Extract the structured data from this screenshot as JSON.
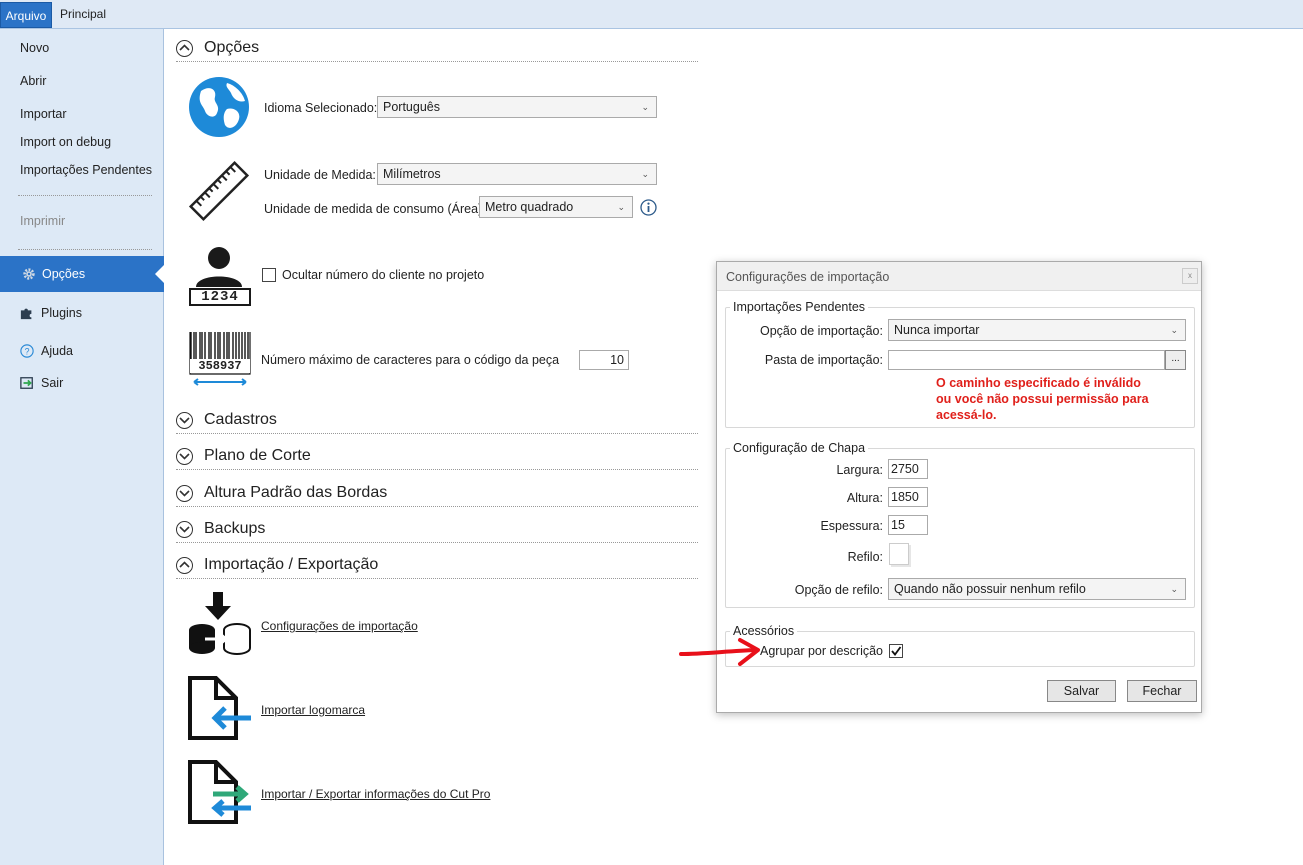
{
  "ribbon": {
    "tab_file": "Arquivo",
    "tab_home": "Principal"
  },
  "sidebar": {
    "new": "Novo",
    "open": "Abrir",
    "import": "Importar",
    "import_debug": "Import on debug",
    "pending": "Importações Pendentes",
    "print": "Imprimir",
    "options": "Opções",
    "plugins": "Plugins",
    "help": "Ajuda",
    "exit": "Sair"
  },
  "main": {
    "options_title": "Opções",
    "language_label": "Idioma Selecionado:",
    "language_value": "Português",
    "unit_label": "Unidade de Medida:",
    "unit_value": "Milímetros",
    "area_unit_label": "Unidade de medida de consumo (Área):",
    "area_unit_value": "Metro quadrado",
    "hide_client_label": "Ocultar número do cliente no projeto",
    "client_number": "1234",
    "barcode_number": "358937",
    "max_chars_label": "Número máximo de caracteres para o código da peça",
    "max_chars_value": "10",
    "sections": [
      "Cadastros",
      "Plano de Corte",
      "Altura Padrão das Bordas",
      "Backups",
      "Importação / Exportação"
    ],
    "link_import_config": "Configurações de importação",
    "link_import_logo": "Importar logomarca",
    "link_import_export": "Importar / Exportar informações do Cut Pro"
  },
  "dialog": {
    "title": "Configurações de importação",
    "close_icon": "x",
    "pending_group": "Importações Pendentes",
    "import_option_label": "Opção de importação:",
    "import_option_value": "Nunca importar",
    "import_folder_label": "Pasta de importação:",
    "import_folder_value": "",
    "browse_label": "...",
    "error_line1": "O caminho especificado é inválido",
    "error_line2": "ou você não possui permissão para",
    "error_line3": "acessá-lo.",
    "sheet_group": "Configuração de Chapa",
    "width_label": "Largura:",
    "width_value": "2750",
    "height_label": "Altura:",
    "height_value": "1850",
    "thickness_label": "Espessura:",
    "thickness_value": "15",
    "trim_label": "Refilo:",
    "trim_option_label": "Opção de refilo:",
    "trim_option_value": "Quando não possuir nenhum refilo",
    "accessories_group": "Acessórios",
    "group_by_desc_label": "Agrupar por descrição",
    "group_by_desc_checked": true,
    "save_label": "Salvar",
    "close_label": "Fechar"
  },
  "colors": {
    "accent": "#2b73c7",
    "error": "#e0201b",
    "arrow": "#e8101a",
    "globe": "#1e8ad8"
  }
}
